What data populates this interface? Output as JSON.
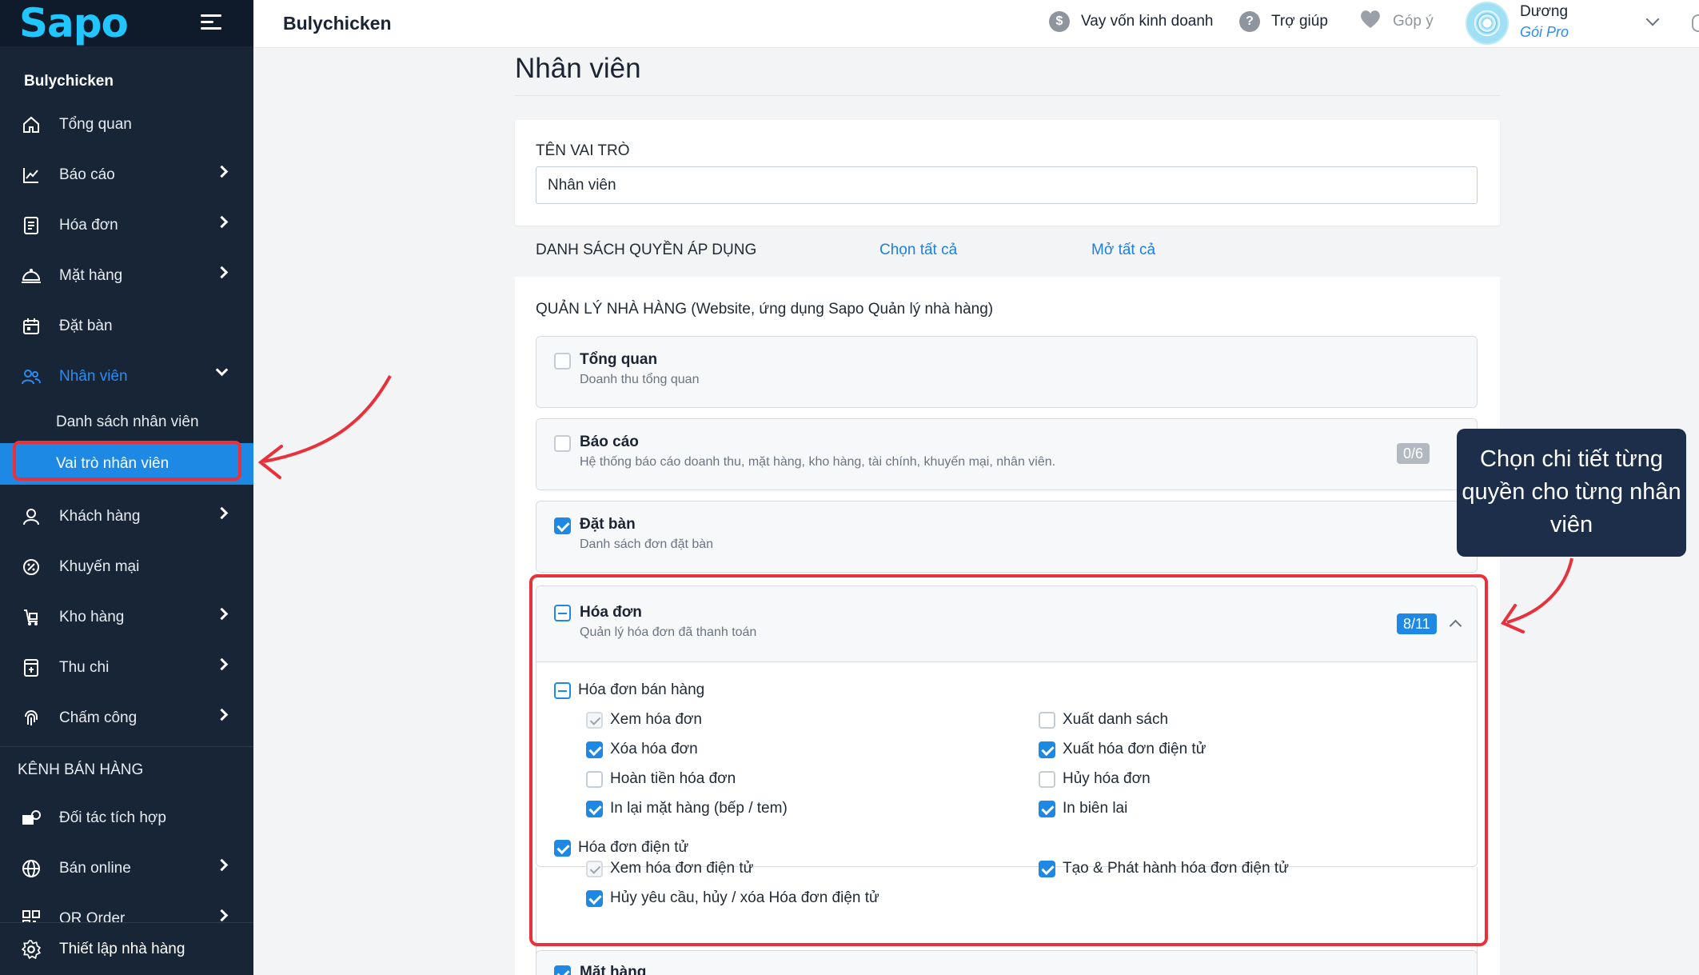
{
  "sidebar": {
    "logo": "Sapo",
    "store_name": "Bulychicken",
    "items": [
      {
        "label": "Tổng quan",
        "icon": "home-icon"
      },
      {
        "label": "Báo cáo",
        "icon": "chart-icon"
      },
      {
        "label": "Hóa đơn",
        "icon": "receipt-icon"
      },
      {
        "label": "Mặt hàng",
        "icon": "dish-icon"
      },
      {
        "label": "Đặt bàn",
        "icon": "calendar-icon"
      },
      {
        "label": "Nhân viên",
        "icon": "users-icon"
      }
    ],
    "sub_items": [
      {
        "label": "Danh sách nhân viên"
      },
      {
        "label": "Vai trò nhân viên"
      }
    ],
    "items2": [
      {
        "label": "Khách hàng",
        "icon": "person-icon"
      },
      {
        "label": "Khuyến mại",
        "icon": "promo-icon"
      },
      {
        "label": "Kho hàng",
        "icon": "warehouse-icon"
      },
      {
        "label": "Thu chi",
        "icon": "cashbook-icon"
      },
      {
        "label": "Chấm công",
        "icon": "fingerprint-icon"
      }
    ],
    "section_label": "KÊNH BÁN HÀNG",
    "items3": [
      {
        "label": "Đối tác tích hợp",
        "icon": "partner-icon"
      },
      {
        "label": "Bán online",
        "icon": "globe-icon"
      },
      {
        "label": "QR Order",
        "icon": "qr-icon"
      }
    ],
    "bottom": {
      "label": "Thiết lập nhà hàng",
      "icon": "gear-icon"
    }
  },
  "header": {
    "title": "Bulychicken",
    "loan": "Vay vốn kinh doanh",
    "help": "Trợ giúp",
    "feedback": "Góp ý",
    "user_name": "Dương",
    "user_plan": "Gói Pro"
  },
  "main": {
    "page_title": "Nhân viên",
    "role_label": "TÊN VAI TRÒ",
    "role_value": "Nhân viên",
    "perm_header": "DANH SÁCH QUYỀN ÁP DỤNG",
    "select_all": "Chọn tất cả",
    "expand_all": "Mở tất cả",
    "group_title": "QUẢN LÝ NHÀ HÀNG (Website, ứng dụng Sapo Quản lý nhà hàng)",
    "modules": [
      {
        "title": "Tổng quan",
        "desc": "Doanh thu tổng quan"
      },
      {
        "title": "Báo cáo",
        "desc": "Hệ thống báo cáo doanh thu, mặt hàng, kho hàng, tài chính, khuyến mại, nhân viên.",
        "badge": "0/6"
      },
      {
        "title": "Đặt bàn",
        "desc": "Danh sách đơn đặt bàn"
      },
      {
        "title": "Hóa đơn",
        "desc": "Quản lý hóa đơn đã thanh toán",
        "badge": "8/11"
      },
      {
        "title": "Mặt hàng"
      }
    ],
    "sub_groups": [
      {
        "title": "Hóa đơn bán hàng",
        "perms": [
          "Xem hóa đơn",
          "Xuất danh sách",
          "Xóa hóa đơn",
          "Xuất hóa đơn điện tử",
          "Hoàn tiền hóa đơn",
          "Hủy hóa đơn",
          "In lại mặt hàng (bếp / tem)",
          "In biên lai"
        ]
      },
      {
        "title": "Hóa đơn điện tử",
        "perms": [
          "Xem hóa đơn điện tử",
          "Tạo & Phát hành hóa đơn điện tử",
          "Hủy yêu cầu, hủy / xóa Hóa đơn điện tử"
        ]
      }
    ]
  },
  "annotation": {
    "tooltip": "Chọn chi tiết từng quyền cho từng nhân viên"
  },
  "colors": {
    "accent": "#1e88e5",
    "sidebar": "#182537",
    "highlight": "#e8313b"
  }
}
